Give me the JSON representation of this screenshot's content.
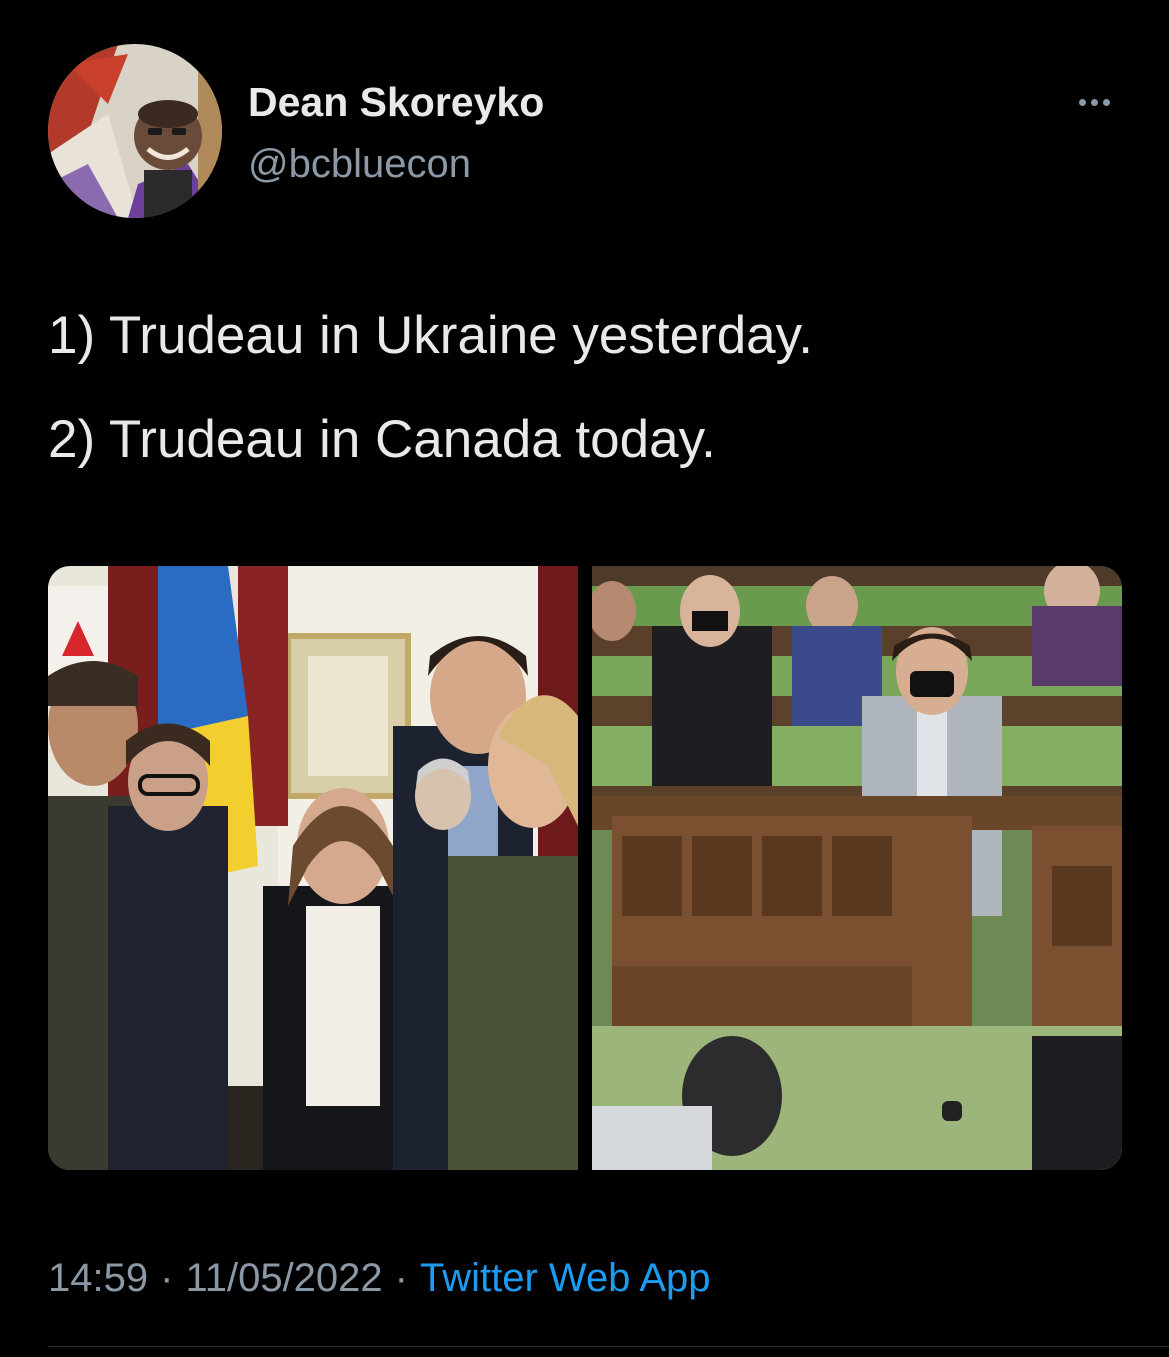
{
  "author": {
    "display_name": "Dean Skoreyko",
    "handle": "@bcbluecon"
  },
  "tweet": {
    "lines": [
      "1) Trudeau in Ukraine yesterday.",
      "2) Trudeau in Canada today."
    ],
    "time": "14:59",
    "date": "11/05/2022",
    "source": "Twitter Web App",
    "separator": "·"
  },
  "icons": {
    "more": "more-horizontal-icon"
  },
  "colors": {
    "background": "#000000",
    "primary_text": "#e7e9ea",
    "secondary_text": "#8b98a5",
    "link": "#1d9bf0",
    "divider": "#2f3336"
  }
}
